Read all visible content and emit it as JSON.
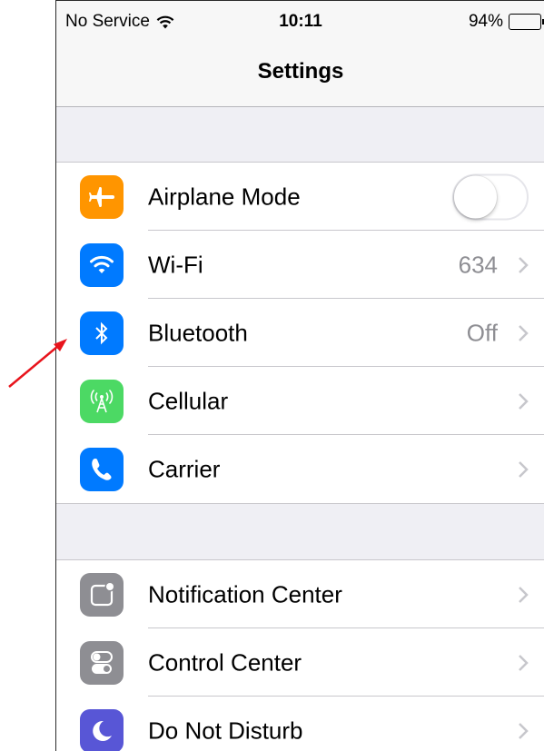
{
  "status_bar": {
    "carrier": "No Service",
    "time": "10:11",
    "battery": "94%",
    "battery_level": 0.94
  },
  "nav": {
    "title": "Settings"
  },
  "groups": [
    {
      "rows": [
        {
          "label": "Airplane Mode",
          "icon": "airplane-icon",
          "icon_color": "#ff9500",
          "accessory": "toggle",
          "toggle_on": false
        },
        {
          "label": "Wi-Fi",
          "icon": "wifi-icon",
          "icon_color": "#007aff",
          "value": "634",
          "accessory": "chevron"
        },
        {
          "label": "Bluetooth",
          "icon": "bluetooth-icon",
          "icon_color": "#007aff",
          "value": "Off",
          "accessory": "chevron"
        },
        {
          "label": "Cellular",
          "icon": "cellular-icon",
          "icon_color": "#4cd964",
          "accessory": "chevron"
        },
        {
          "label": "Carrier",
          "icon": "phone-icon",
          "icon_color": "#007aff",
          "accessory": "chevron"
        }
      ]
    },
    {
      "rows": [
        {
          "label": "Notification Center",
          "icon": "notification-center-icon",
          "icon_color": "#8e8e93",
          "accessory": "chevron"
        },
        {
          "label": "Control Center",
          "icon": "control-center-icon",
          "icon_color": "#8e8e93",
          "accessory": "chevron"
        },
        {
          "label": "Do Not Disturb",
          "icon": "moon-icon",
          "icon_color": "#5856d6",
          "accessory": "chevron"
        }
      ]
    }
  ],
  "colors": {
    "annotation_arrow": "#e8141c",
    "chevron": "#c7c7cc"
  }
}
